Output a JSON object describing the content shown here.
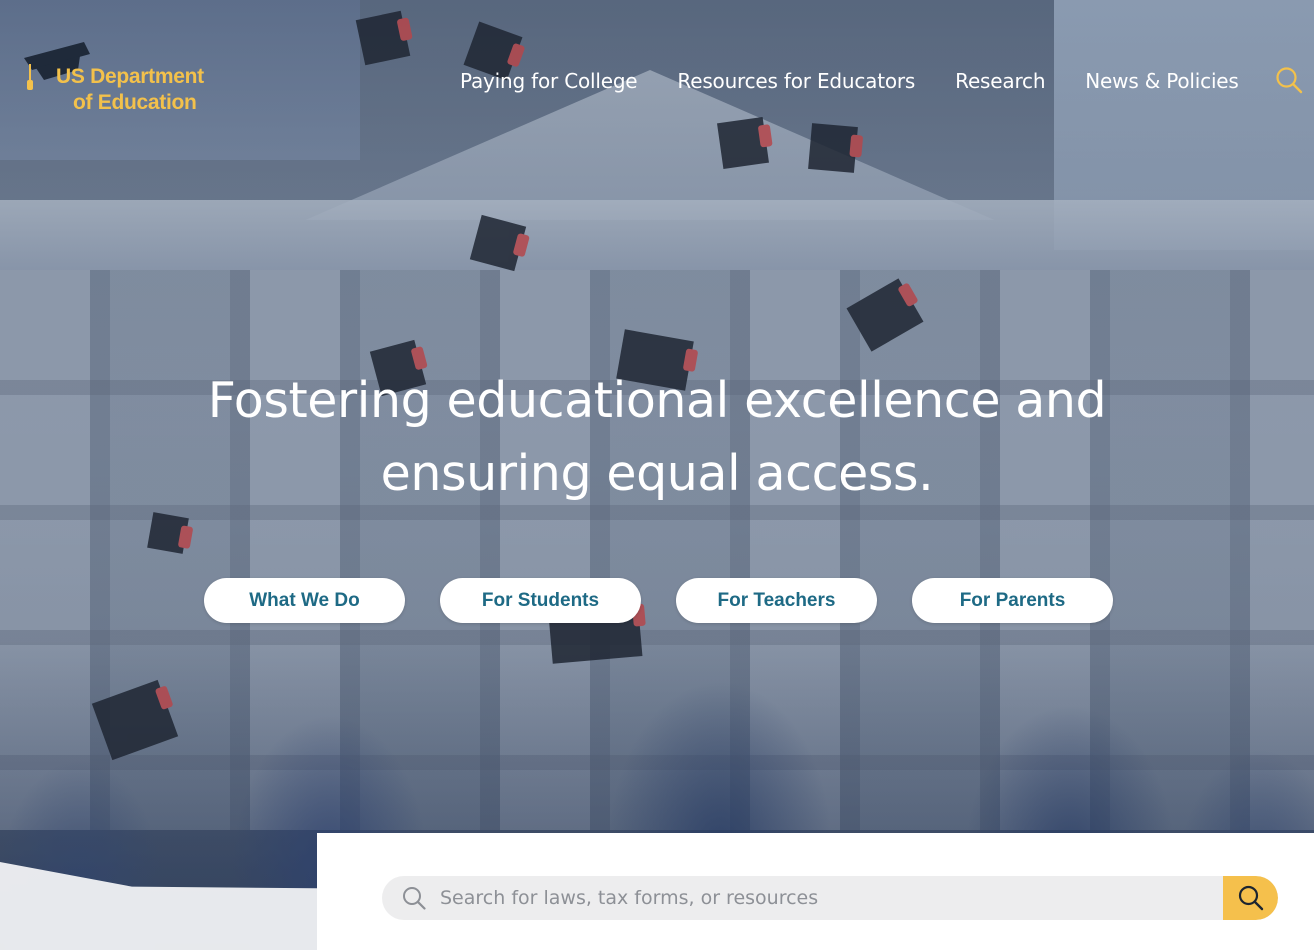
{
  "brand": {
    "line1": "US Department",
    "line2": "of Education",
    "color": "#f3c14b",
    "icon": "graduation-cap-icon"
  },
  "nav": {
    "items": [
      {
        "label": "Paying for College"
      },
      {
        "label": "Resources for Educators"
      },
      {
        "label": "Research"
      },
      {
        "label": "News & Policies"
      }
    ],
    "search_icon": "search-icon"
  },
  "hero": {
    "headline_line1": "Fostering educational excellence and",
    "headline_line2": "ensuring equal access."
  },
  "audience_buttons": [
    {
      "label": "What We Do"
    },
    {
      "label": "For Students"
    },
    {
      "label": "For Teachers"
    },
    {
      "label": "For Parents"
    }
  ],
  "search": {
    "placeholder": "Search for laws, tax forms, or resources",
    "value": "",
    "submit_icon": "search-icon"
  },
  "colors": {
    "accent": "#f5c04c",
    "button_text": "#1e6a85",
    "search_bg": "#ededee"
  }
}
